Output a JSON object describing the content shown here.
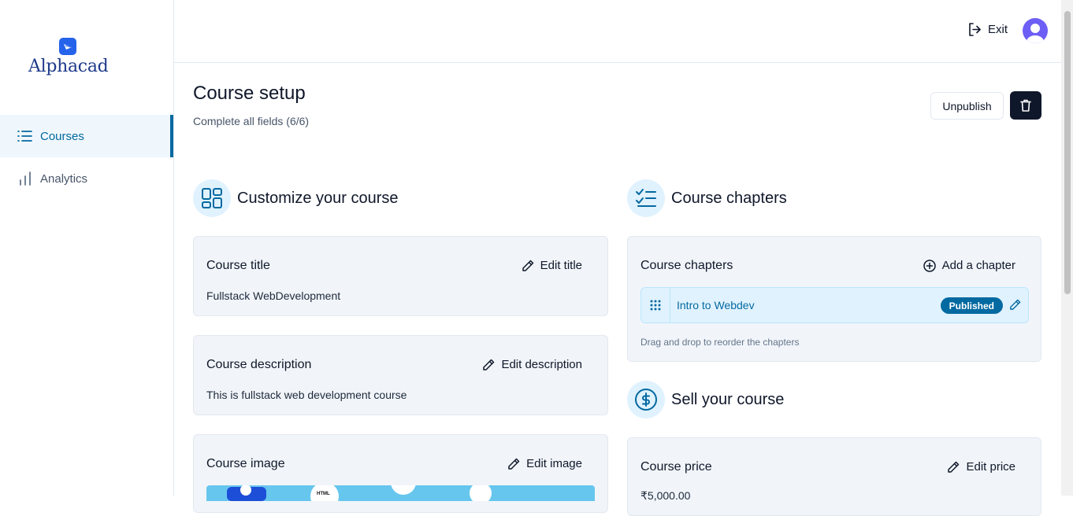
{
  "brand": {
    "name": "Alphacad"
  },
  "sidebar": {
    "items": [
      {
        "label": "Courses",
        "icon": "list-icon",
        "active": true
      },
      {
        "label": "Analytics",
        "icon": "bar-chart-icon",
        "active": false
      }
    ]
  },
  "topbar": {
    "exit_label": "Exit"
  },
  "page": {
    "title": "Course setup",
    "subtitle": "Complete all fields (6/6)",
    "unpublish_label": "Unpublish"
  },
  "customize": {
    "heading": "Customize your course",
    "title_card": {
      "label": "Course title",
      "action": "Edit title",
      "value": "Fullstack WebDevelopment"
    },
    "description_card": {
      "label": "Course description",
      "action": "Edit description",
      "value": "This is fullstack web development course"
    },
    "image_card": {
      "label": "Course image",
      "action": "Edit image",
      "image_text": "HTML"
    }
  },
  "chapters": {
    "heading": "Course chapters",
    "card_label": "Course chapters",
    "add_label": "Add a chapter",
    "items": [
      {
        "title": "Intro to Webdev",
        "status": "Published"
      }
    ],
    "hint": "Drag and drop to reorder the chapters"
  },
  "sell": {
    "heading": "Sell your course",
    "price_card": {
      "label": "Course price",
      "action": "Edit price",
      "value": "₹5,000.00"
    }
  },
  "colors": {
    "accent": "#0369a1",
    "accent_light": "#e0f2fe",
    "dark": "#0f172a",
    "avatar": "#6d5ef5"
  }
}
